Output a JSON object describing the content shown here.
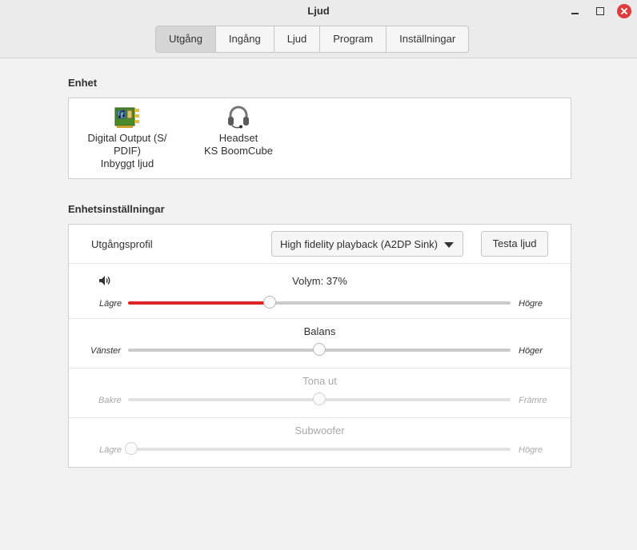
{
  "window": {
    "title": "Ljud"
  },
  "tabs": [
    {
      "label": "Utgång",
      "active": true
    },
    {
      "label": "Ingång",
      "active": false
    },
    {
      "label": "Ljud",
      "active": false
    },
    {
      "label": "Program",
      "active": false
    },
    {
      "label": "Inställningar",
      "active": false
    }
  ],
  "device_section": {
    "title": "Enhet",
    "devices": [
      {
        "name_line1": "Digital Output (S/",
        "name_line2": "PDIF)",
        "name_line3": "Inbyggt ljud",
        "icon": "sound-card-icon"
      },
      {
        "name_line1": "Headset",
        "name_line2": "KS BoomCube",
        "icon": "headset-icon"
      }
    ]
  },
  "settings_section": {
    "title": "Enhetsinställningar",
    "profile": {
      "label": "Utgångsprofil",
      "value": "High fidelity playback (A2DP Sink)",
      "test_button": "Testa ljud"
    },
    "volume": {
      "label": "Volym: 37%",
      "left": "Lägre",
      "right": "Högre",
      "percent": 37,
      "icon": "speaker-icon"
    },
    "balance": {
      "label": "Balans",
      "left": "Vänster",
      "right": "Höger",
      "percent": 50
    },
    "fade": {
      "label": "Tona ut",
      "left": "Bakre",
      "right": "Främre",
      "percent": 50,
      "enabled": false
    },
    "subwoofer": {
      "label": "Subwoofer",
      "left": "Lägre",
      "right": "Högre",
      "percent": 0,
      "enabled": false
    }
  },
  "colors": {
    "accent": "#dc2626"
  }
}
